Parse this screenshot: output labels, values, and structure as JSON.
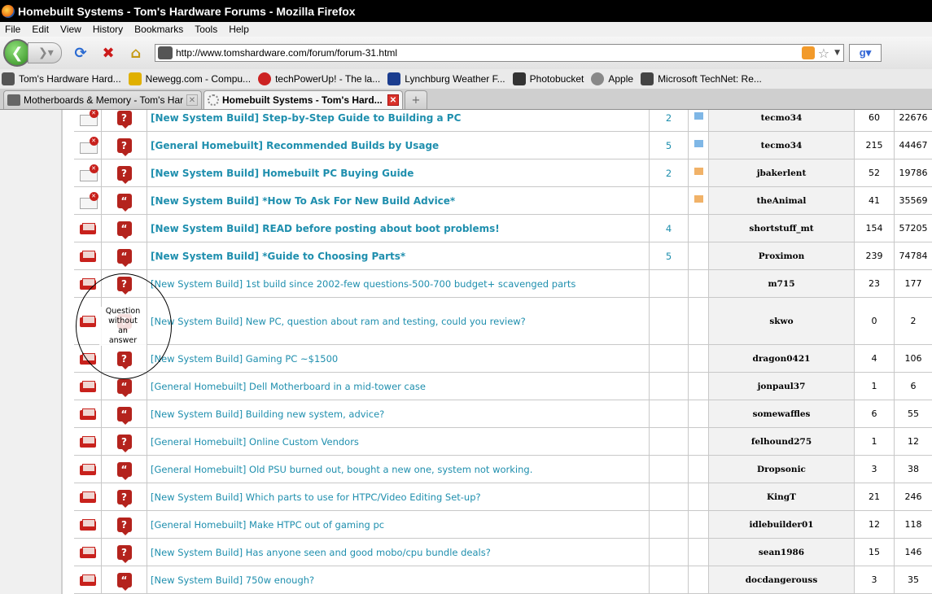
{
  "window": {
    "title": "Homebuilt Systems - Tom's Hardware Forums - Mozilla Firefox"
  },
  "menu": [
    "File",
    "Edit",
    "View",
    "History",
    "Bookmarks",
    "Tools",
    "Help"
  ],
  "nav": {
    "url": "http://www.tomshardware.com/forum/forum-31.html",
    "search_engine_icon": "google-icon"
  },
  "bookmarks": [
    {
      "label": "Tom's Hardware Hard...",
      "color": "#555555"
    },
    {
      "label": "Newegg.com - Compu...",
      "color": "#e0b000"
    },
    {
      "label": "techPowerUp! - The la...",
      "color": "#cc2222"
    },
    {
      "label": "Lynchburg Weather F...",
      "color": "#1b3d8f"
    },
    {
      "label": "Photobucket",
      "color": "#333333"
    },
    {
      "label": "Apple",
      "color": "#888888"
    },
    {
      "label": "Microsoft TechNet: Re...",
      "color": "#444444"
    }
  ],
  "tabs": [
    {
      "label": "Motherboards & Memory - Tom's Hardw..."
    },
    {
      "label": "Homebuilt Systems - Tom's Hard..."
    }
  ],
  "annotation": "Question\nwithout\nan\nanswer",
  "threads": [
    {
      "folder": "locked",
      "icon": "question",
      "title": "[New System Build] Step-by-Step Guide to Building a PC",
      "sticky": true,
      "pages": "2",
      "flag": "blue",
      "author": "tecmo34",
      "replies": "60",
      "views": "22676"
    },
    {
      "folder": "locked",
      "icon": "question",
      "title": "[General Homebuilt] Recommended Builds by Usage",
      "sticky": true,
      "pages": "5",
      "flag": "blue",
      "author": "tecmo34",
      "replies": "215",
      "views": "44467"
    },
    {
      "folder": "locked",
      "icon": "question",
      "title": "[New System Build] Homebuilt PC Buying Guide",
      "sticky": true,
      "pages": "2",
      "flag": "orange",
      "author": "jbakerlent",
      "replies": "52",
      "views": "19786"
    },
    {
      "folder": "locked",
      "icon": "quote",
      "title": "[New System Build] *How To Ask For New Build Advice*",
      "sticky": true,
      "pages": "",
      "flag": "orange",
      "author": "theAnimal",
      "replies": "41",
      "views": "35569"
    },
    {
      "folder": "open",
      "icon": "quote",
      "title": "[New System Build] READ before posting about boot problems!",
      "sticky": true,
      "pages": "4",
      "flag": "",
      "author": "shortstuff_mt",
      "replies": "154",
      "views": "57205"
    },
    {
      "folder": "open",
      "icon": "quote",
      "title": "[New System Build] *Guide to Choosing Parts*",
      "sticky": true,
      "pages": "5",
      "flag": "",
      "author": "Proximon",
      "replies": "239",
      "views": "74784"
    },
    {
      "folder": "open",
      "icon": "question",
      "title": "[New System Build] 1st build since 2002-few questions-500-700 budget+ scavenged parts",
      "sticky": false,
      "pages": "",
      "flag": "",
      "author": "m715",
      "replies": "23",
      "views": "177"
    },
    {
      "folder": "open",
      "icon": "question",
      "title": "[New System Build] New PC, question about ram and testing, could you review?",
      "sticky": false,
      "pages": "",
      "flag": "",
      "author": "skwo",
      "replies": "0",
      "views": "2",
      "tall": true
    },
    {
      "folder": "open",
      "icon": "question",
      "title": "[New System Build] Gaming PC ~$1500",
      "sticky": false,
      "pages": "",
      "flag": "",
      "author": "dragon0421",
      "replies": "4",
      "views": "106"
    },
    {
      "folder": "open",
      "icon": "quote",
      "title": "[General Homebuilt] Dell Motherboard in a mid-tower case",
      "sticky": false,
      "pages": "",
      "flag": "",
      "author": "jonpaul37",
      "replies": "1",
      "views": "6"
    },
    {
      "folder": "open",
      "icon": "quote",
      "title": "[New System Build] Building new system, advice?",
      "sticky": false,
      "pages": "",
      "flag": "",
      "author": "somewaffles",
      "replies": "6",
      "views": "55"
    },
    {
      "folder": "open",
      "icon": "question",
      "title": "[General Homebuilt] Online Custom Vendors",
      "sticky": false,
      "pages": "",
      "flag": "",
      "author": "felhound275",
      "replies": "1",
      "views": "12"
    },
    {
      "folder": "open",
      "icon": "quote",
      "title": "[General Homebuilt] Old PSU burned out, bought a new one, system not working.",
      "sticky": false,
      "pages": "",
      "flag": "",
      "author": "Dropsonic",
      "replies": "3",
      "views": "38"
    },
    {
      "folder": "open",
      "icon": "question",
      "title": "[New System Build] Which parts to use for HTPC/Video Editing Set-up?",
      "sticky": false,
      "pages": "",
      "flag": "",
      "author": "KingT",
      "replies": "21",
      "views": "246"
    },
    {
      "folder": "open",
      "icon": "question",
      "title": "[General Homebuilt] Make HTPC out of gaming pc",
      "sticky": false,
      "pages": "",
      "flag": "",
      "author": "idlebuilder01",
      "replies": "12",
      "views": "118"
    },
    {
      "folder": "open",
      "icon": "question",
      "title": "[New System Build] Has anyone seen and good mobo/cpu bundle deals?",
      "sticky": false,
      "pages": "",
      "flag": "",
      "author": "sean1986",
      "replies": "15",
      "views": "146"
    },
    {
      "folder": "open",
      "icon": "quote",
      "title": "[New System Build] 750w enough?",
      "sticky": false,
      "pages": "",
      "flag": "",
      "author": "docdangerouss",
      "replies": "3",
      "views": "35"
    }
  ]
}
